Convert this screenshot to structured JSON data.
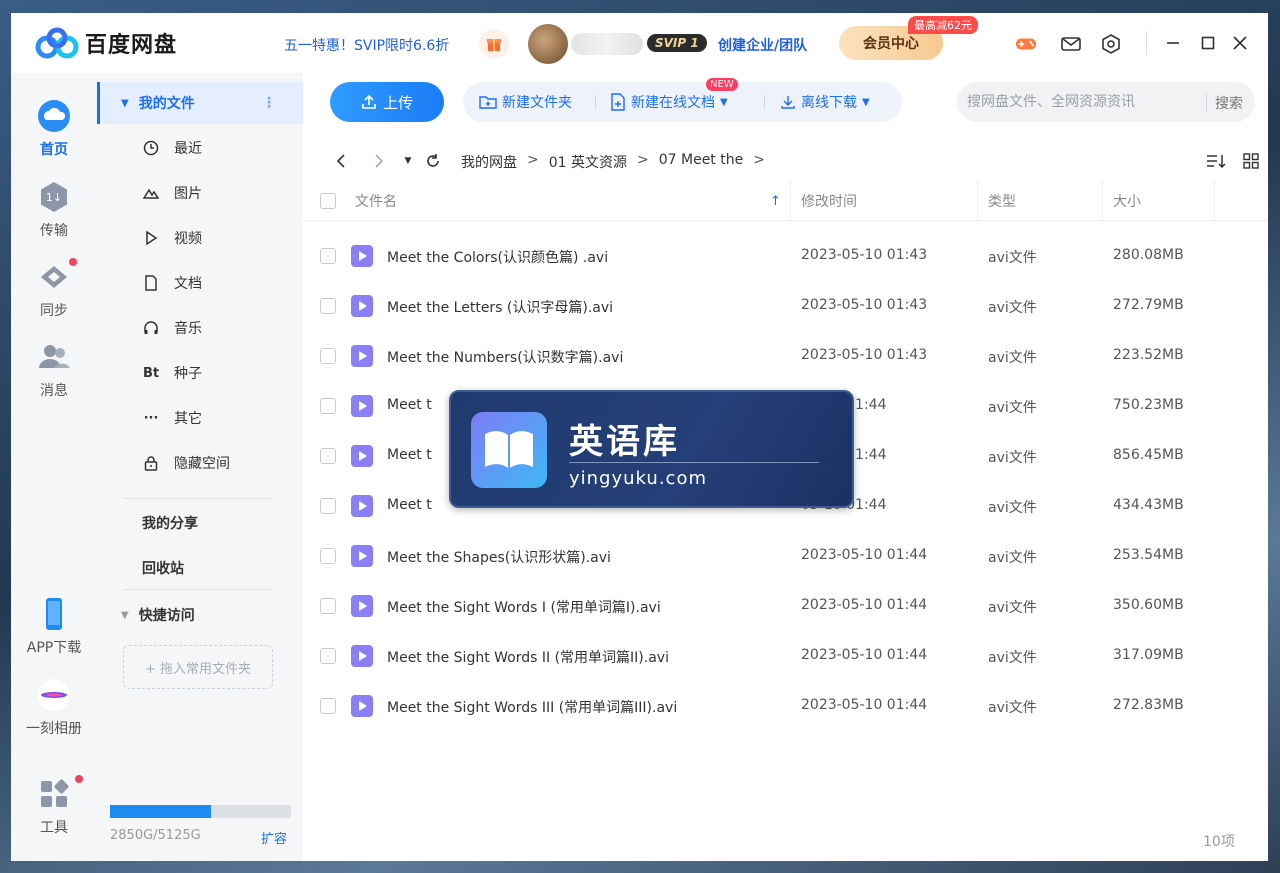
{
  "app": {
    "title": "百度网盘",
    "promo": "五一特惠！SVIP限时6.6折",
    "svip_badge": "SVIP 1",
    "team_link": "创建企业/团队",
    "vip_center": "会员中心",
    "vip_tag": "最高减62元"
  },
  "rail": {
    "items": [
      {
        "label": "首页",
        "icon": "cloud-home-icon"
      },
      {
        "label": "传输",
        "icon": "transfer-icon"
      },
      {
        "label": "同步",
        "icon": "sync-icon"
      },
      {
        "label": "消息",
        "icon": "message-icon"
      },
      {
        "label": "APP下载",
        "icon": "phone-icon"
      },
      {
        "label": "一刻相册",
        "icon": "album-icon"
      },
      {
        "label": "工具",
        "icon": "tools-icon"
      }
    ]
  },
  "nav": {
    "my_files": "我的文件",
    "categories": [
      {
        "label": "最近",
        "icon": "clock-icon"
      },
      {
        "label": "图片",
        "icon": "image-icon"
      },
      {
        "label": "视频",
        "icon": "video-icon"
      },
      {
        "label": "文档",
        "icon": "document-icon"
      },
      {
        "label": "音乐",
        "icon": "headphones-icon"
      },
      {
        "label": "种子",
        "icon": "bt-icon",
        "glyph": "Bt"
      },
      {
        "label": "其它",
        "icon": "more-icon",
        "glyph": "···"
      },
      {
        "label": "隐藏空间",
        "icon": "lock-icon"
      }
    ],
    "my_share": "我的分享",
    "recycle": "回收站",
    "quick_access": "快捷访问",
    "drop_hint": "+ 拖入常用文件夹",
    "quota": "2850G/5125G",
    "quota_used_fraction": 0.556,
    "expand": "扩容"
  },
  "toolbar": {
    "upload": "上传",
    "new_folder": "新建文件夹",
    "new_online_doc": "新建在线文档",
    "new_tag": "NEW",
    "offline_download": "离线下载",
    "search_placeholder": "搜网盘文件、全网资源资讯",
    "search_button": "搜索"
  },
  "breadcrumb": {
    "items": [
      "我的网盘",
      "01 英文资源",
      "07 Meet the"
    ],
    "separator": ">"
  },
  "table": {
    "headers": {
      "name": "文件名",
      "modified": "修改时间",
      "type": "类型",
      "size": "大小"
    },
    "rows": [
      {
        "name": "Meet the Colors(认识颜色篇) .avi",
        "date": "2023-05-10 01:43",
        "type": "avi文件",
        "size": "280.08MB"
      },
      {
        "name": "Meet the Letters (认识字母篇).avi",
        "date": "2023-05-10 01:43",
        "type": "avi文件",
        "size": "272.79MB"
      },
      {
        "name": "Meet the Numbers(认识数字篇).avi",
        "date": "2023-05-10 01:43",
        "type": "avi文件",
        "size": "223.52MB"
      },
      {
        "name": "Meet t",
        "date": "05-10 01:44",
        "type": "avi文件",
        "size": "750.23MB"
      },
      {
        "name": "Meet t",
        "date": "05-10 01:44",
        "type": "avi文件",
        "size": "856.45MB"
      },
      {
        "name": "Meet t",
        "date": "05-10 01:44",
        "type": "avi文件",
        "size": "434.43MB"
      },
      {
        "name": "Meet the Shapes(认识形状篇).avi",
        "date": "2023-05-10 01:44",
        "type": "avi文件",
        "size": "253.54MB"
      },
      {
        "name": "Meet the Sight Words I (常用单词篇I).avi",
        "date": "2023-05-10 01:44",
        "type": "avi文件",
        "size": "350.60MB"
      },
      {
        "name": "Meet the Sight Words II (常用单词篇II).avi",
        "date": "2023-05-10 01:44",
        "type": "avi文件",
        "size": "317.09MB"
      },
      {
        "name": "Meet the Sight Words III (常用单词篇III).avi",
        "date": "2023-05-10 01:44",
        "type": "avi文件",
        "size": "272.83MB"
      }
    ],
    "count": "10项"
  },
  "watermark": {
    "title": "英语库",
    "url": "yingyuku.com"
  },
  "colors": {
    "accent": "#1c6ef3",
    "file_icon": "#8b7ff5",
    "badge_red": "#f6415c"
  }
}
